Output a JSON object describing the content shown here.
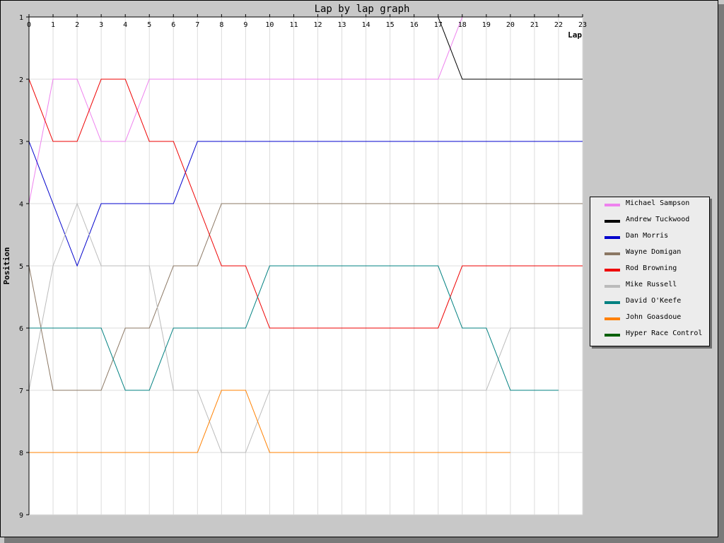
{
  "chart_data": {
    "type": "line",
    "title": "Lap by lap graph",
    "xlabel": "Lap",
    "ylabel": "Position",
    "x_ticks": [
      0,
      1,
      2,
      3,
      4,
      5,
      6,
      7,
      8,
      9,
      10,
      11,
      12,
      13,
      14,
      15,
      16,
      17,
      18,
      19,
      20,
      21,
      22,
      23
    ],
    "y_ticks": [
      1,
      2,
      3,
      4,
      5,
      6,
      7,
      8,
      9
    ],
    "xlim": [
      0,
      23
    ],
    "ylim": [
      1,
      9
    ],
    "y_inverted": true,
    "x_axis_position": "top",
    "grid": true,
    "legend_position": "right",
    "series": [
      {
        "name": "Michael Sampson",
        "color": "#ee82ee",
        "values": [
          4,
          2,
          2,
          3,
          3,
          2,
          2,
          2,
          2,
          2,
          2,
          2,
          2,
          2,
          2,
          2,
          2,
          2,
          1,
          1,
          1,
          1,
          1,
          1
        ]
      },
      {
        "name": "Andrew Tuckwood",
        "color": "#000000",
        "values": [
          1,
          1,
          1,
          1,
          1,
          1,
          1,
          1,
          1,
          1,
          1,
          1,
          1,
          1,
          1,
          1,
          1,
          1,
          2,
          2,
          2,
          2,
          2,
          2
        ]
      },
      {
        "name": "Dan Morris",
        "color": "#0000cc",
        "values": [
          3,
          4,
          5,
          4,
          4,
          4,
          4,
          3,
          3,
          3,
          3,
          3,
          3,
          3,
          3,
          3,
          3,
          3,
          3,
          3,
          3,
          3,
          3,
          3
        ]
      },
      {
        "name": "Wayne Domigan",
        "color": "#8b7763",
        "values": [
          5,
          7,
          7,
          7,
          6,
          6,
          5,
          5,
          4,
          4,
          4,
          4,
          4,
          4,
          4,
          4,
          4,
          4,
          4,
          4,
          4,
          4,
          4,
          4
        ]
      },
      {
        "name": "Rod Browning",
        "color": "#ee0000",
        "values": [
          2,
          3,
          3,
          2,
          2,
          3,
          3,
          4,
          5,
          5,
          6,
          6,
          6,
          6,
          6,
          6,
          6,
          6,
          5,
          5,
          5,
          5,
          5,
          5
        ]
      },
      {
        "name": "Mike Russell",
        "color": "#bbbbbb",
        "values": [
          7,
          5,
          4,
          5,
          5,
          5,
          7,
          7,
          8,
          8,
          7,
          7,
          7,
          7,
          7,
          7,
          7,
          7,
          7,
          7,
          6,
          6,
          6,
          6
        ]
      },
      {
        "name": "David O'Keefe",
        "color": "#008080",
        "values": [
          6,
          6,
          6,
          6,
          7,
          7,
          6,
          6,
          6,
          6,
          5,
          5,
          5,
          5,
          5,
          5,
          5,
          5,
          6,
          6,
          7,
          7,
          7
        ]
      },
      {
        "name": "John Goasdoue",
        "color": "#ff8000",
        "values": [
          8,
          8,
          8,
          8,
          8,
          8,
          8,
          8,
          7,
          7,
          8,
          8,
          8,
          8,
          8,
          8,
          8,
          8,
          8,
          8,
          8
        ]
      },
      {
        "name": "Hyper Race Control",
        "color": "#006000",
        "values": []
      }
    ]
  }
}
